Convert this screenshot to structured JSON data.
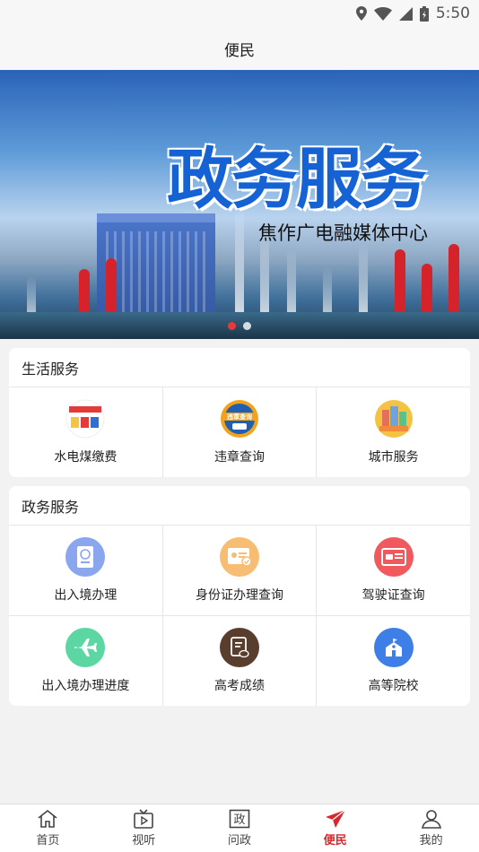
{
  "status_bar": {
    "time": "5:50",
    "icons": [
      "location-icon",
      "wifi-icon",
      "signal-icon",
      "battery-icon"
    ]
  },
  "header": {
    "title": "便民"
  },
  "banner": {
    "headline": "政务服务",
    "subhead": "焦作广电融媒体中心",
    "slide_count": 2,
    "active_slide": 1
  },
  "life_services": {
    "title": "生活服务",
    "items": [
      {
        "label": "水电煤缴费",
        "icon": "utility-bill-icon"
      },
      {
        "label": "违章查询",
        "icon": "traffic-violation-icon"
      },
      {
        "label": "城市服务",
        "icon": "city-service-icon"
      }
    ]
  },
  "gov_services": {
    "title": "政务服务",
    "items": [
      {
        "label": "出入境办理",
        "icon": "passport-icon",
        "color": "#8aa6ef"
      },
      {
        "label": "身份证办理查询",
        "icon": "id-card-icon",
        "color": "#f6bd73"
      },
      {
        "label": "驾驶证查询",
        "icon": "driver-license-icon",
        "color": "#f05a5f"
      },
      {
        "label": "出入境办理进度",
        "icon": "airplane-icon",
        "color": "#5cd6a3"
      },
      {
        "label": "高考成绩",
        "icon": "exam-score-icon",
        "color": "#5a3e2d"
      },
      {
        "label": "高等院校",
        "icon": "university-icon",
        "color": "#3d7fe6"
      }
    ]
  },
  "tabbar": {
    "active": "便民",
    "items": [
      {
        "label": "首页",
        "icon": "home-icon"
      },
      {
        "label": "视听",
        "icon": "tv-icon"
      },
      {
        "label": "问政",
        "icon": "gov-icon"
      },
      {
        "label": "便民",
        "icon": "send-icon"
      },
      {
        "label": "我的",
        "icon": "person-icon"
      }
    ]
  },
  "colors": {
    "accent": "#d8262c",
    "banner_text": "#1562d4"
  }
}
